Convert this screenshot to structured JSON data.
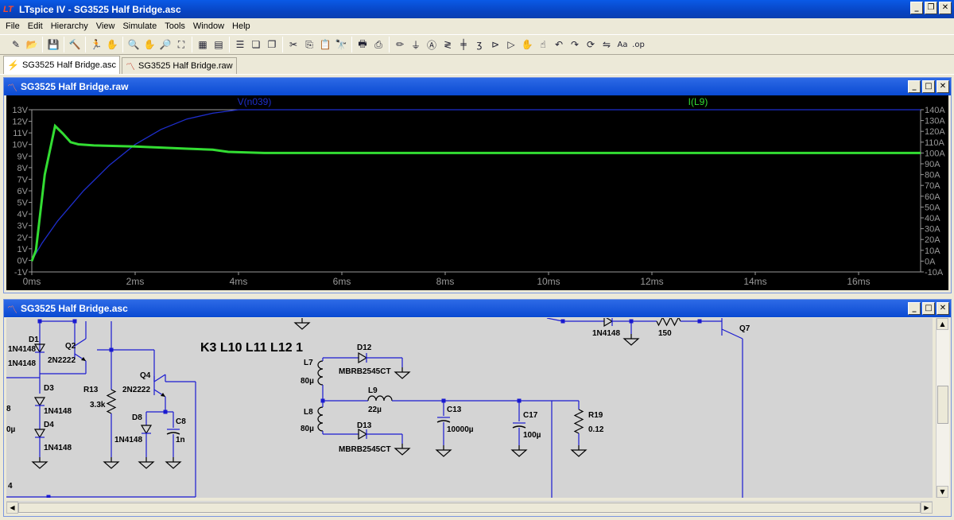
{
  "window": {
    "app_icon": "LT",
    "title": "LTspice IV - SG3525 Half Bridge.asc",
    "minimize": "_",
    "restore": "❐",
    "close": "✕"
  },
  "menu": [
    "File",
    "Edit",
    "Hierarchy",
    "View",
    "Simulate",
    "Tools",
    "Window",
    "Help"
  ],
  "toolbar": [
    {
      "name": "new-schematic-icon",
      "glyph": "✎"
    },
    {
      "name": "open-icon",
      "glyph": "📂"
    },
    {
      "sep": true
    },
    {
      "name": "save-icon",
      "glyph": "💾"
    },
    {
      "sep": true
    },
    {
      "name": "control-panel-icon",
      "glyph": "🔨"
    },
    {
      "sep": true
    },
    {
      "name": "run-icon",
      "glyph": "🏃"
    },
    {
      "name": "halt-icon",
      "glyph": "✋"
    },
    {
      "sep": true
    },
    {
      "name": "zoom-in-icon",
      "glyph": "🔍"
    },
    {
      "name": "pan-icon",
      "glyph": "✋"
    },
    {
      "name": "zoom-out-icon",
      "glyph": "🔎"
    },
    {
      "name": "zoom-fit-icon",
      "glyph": "⛶"
    },
    {
      "sep": true
    },
    {
      "name": "autorange-icon",
      "glyph": "▦"
    },
    {
      "name": "delete-waveform-icon",
      "glyph": "▤"
    },
    {
      "sep": true
    },
    {
      "name": "tile-horizontal-icon",
      "glyph": "☰"
    },
    {
      "name": "cascade-icon",
      "glyph": "❏"
    },
    {
      "name": "tile-vertical-icon",
      "glyph": "❐"
    },
    {
      "sep": true
    },
    {
      "name": "cut-icon",
      "glyph": "✂"
    },
    {
      "name": "copy-icon",
      "glyph": "⎘"
    },
    {
      "name": "paste-icon",
      "glyph": "📋"
    },
    {
      "name": "find-icon",
      "glyph": "🔭"
    },
    {
      "sep": true
    },
    {
      "name": "print-setup-icon",
      "glyph": "🖶"
    },
    {
      "name": "print-icon",
      "glyph": "⎙"
    },
    {
      "sep": true
    },
    {
      "name": "wire-icon",
      "glyph": "✏"
    },
    {
      "name": "ground-icon",
      "glyph": "⏚"
    },
    {
      "name": "label-net-icon",
      "glyph": "Ⓐ"
    },
    {
      "name": "resistor-icon",
      "glyph": "≷"
    },
    {
      "name": "capacitor-icon",
      "glyph": "╪"
    },
    {
      "name": "inductor-icon",
      "glyph": "ʒ"
    },
    {
      "name": "diode-icon",
      "glyph": "⊳"
    },
    {
      "name": "component-icon",
      "glyph": "▷"
    },
    {
      "name": "move-icon",
      "glyph": "✋"
    },
    {
      "name": "drag-icon",
      "glyph": "☝"
    },
    {
      "name": "undo-icon",
      "glyph": "↶"
    },
    {
      "name": "redo-icon",
      "glyph": "↷"
    },
    {
      "name": "rotate-icon",
      "glyph": "⟳"
    },
    {
      "name": "mirror-icon",
      "glyph": "⇋"
    },
    {
      "name": "text-icon",
      "glyph": "Aa"
    },
    {
      "name": "spice-directive-icon",
      "glyph": ".op"
    }
  ],
  "tabs": [
    {
      "label": "SG3525 Half Bridge.asc",
      "icon": "schematic-icon",
      "active": true
    },
    {
      "label": "SG3525 Half Bridge.raw",
      "icon": "waveform-icon",
      "active": false
    }
  ],
  "plot_window": {
    "title": "SG3525 Half Bridge.raw",
    "chart_data": {
      "type": "line",
      "series": [
        {
          "name": "V(n039)",
          "color": "#1e2ecc",
          "axis": "left",
          "x": [
            0,
            0.2,
            0.5,
            1.0,
            1.5,
            2.0,
            2.5,
            3.0,
            3.5,
            4.0,
            5.0,
            17.2
          ],
          "y": [
            0,
            1.5,
            3.4,
            6.0,
            8.2,
            10.0,
            11.3,
            12.2,
            12.7,
            13.0,
            13.0,
            13.0
          ]
        },
        {
          "name": "I(L9)",
          "color": "#33dd33",
          "axis": "right",
          "x": [
            0,
            0.08,
            0.25,
            0.45,
            0.6,
            0.75,
            0.9,
            1.2,
            2.0,
            3.0,
            3.5,
            3.8,
            4.5,
            17.2
          ],
          "y": [
            0,
            10,
            80,
            125,
            118,
            110,
            108,
            107,
            106,
            104,
            103,
            101,
            100,
            100
          ]
        }
      ],
      "x_ticks": [
        "0ms",
        "2ms",
        "4ms",
        "6ms",
        "8ms",
        "10ms",
        "12ms",
        "14ms",
        "16ms"
      ],
      "x_tick_values": [
        0,
        2,
        4,
        6,
        8,
        10,
        12,
        14,
        16
      ],
      "xlim": [
        0,
        17.2
      ],
      "y_left_ticks": [
        "13V",
        "12V",
        "11V",
        "10V",
        "9V",
        "8V",
        "7V",
        "6V",
        "5V",
        "4V",
        "3V",
        "2V",
        "1V",
        "0V",
        "-1V"
      ],
      "y_left_values": [
        13,
        12,
        11,
        10,
        9,
        8,
        7,
        6,
        5,
        4,
        3,
        2,
        1,
        0,
        -1
      ],
      "ylim_left": [
        -1,
        13
      ],
      "y_right_ticks": [
        "140A",
        "130A",
        "120A",
        "110A",
        "100A",
        "90A",
        "80A",
        "70A",
        "60A",
        "50A",
        "40A",
        "30A",
        "20A",
        "10A",
        "0A",
        "-10A"
      ],
      "y_right_values": [
        140,
        130,
        120,
        110,
        100,
        90,
        80,
        70,
        60,
        50,
        40,
        30,
        20,
        10,
        0,
        -10
      ],
      "ylim_right": [
        -10,
        140
      ],
      "grid": false
    }
  },
  "schematic_window": {
    "title": "SG3525 Half Bridge.asc",
    "directive": "K3 L10 L11 L12 1",
    "labels": [
      {
        "text": "D1"
      },
      {
        "text": "1N4148"
      },
      {
        "text": "1N4148"
      },
      {
        "text": "Q2"
      },
      {
        "text": "2N2222"
      },
      {
        "text": "D3"
      },
      {
        "text": "1N4148"
      },
      {
        "text": "D4"
      },
      {
        "text": "1N4148"
      },
      {
        "text": "R13"
      },
      {
        "text": "3.3k"
      },
      {
        "text": "Q4"
      },
      {
        "text": "2N2222"
      },
      {
        "text": "D8"
      },
      {
        "text": "1N4148"
      },
      {
        "text": "C8"
      },
      {
        "text": "1n"
      },
      {
        "text": "L7"
      },
      {
        "text": "80µ"
      },
      {
        "text": "L8"
      },
      {
        "text": "80µ"
      },
      {
        "text": "D12"
      },
      {
        "text": "MBRB2545CT"
      },
      {
        "text": "D13"
      },
      {
        "text": "MBRB2545CT"
      },
      {
        "text": "L9"
      },
      {
        "text": "22µ"
      },
      {
        "text": "C13"
      },
      {
        "text": "10000µ"
      },
      {
        "text": "C17"
      },
      {
        "text": "100µ"
      },
      {
        "text": "R19"
      },
      {
        "text": "0.12"
      },
      {
        "text": "1N4148"
      },
      {
        "text": "150"
      },
      {
        "text": "Q7"
      },
      {
        "text": "8"
      },
      {
        "text": "0µ"
      },
      {
        "text": "4"
      }
    ]
  }
}
